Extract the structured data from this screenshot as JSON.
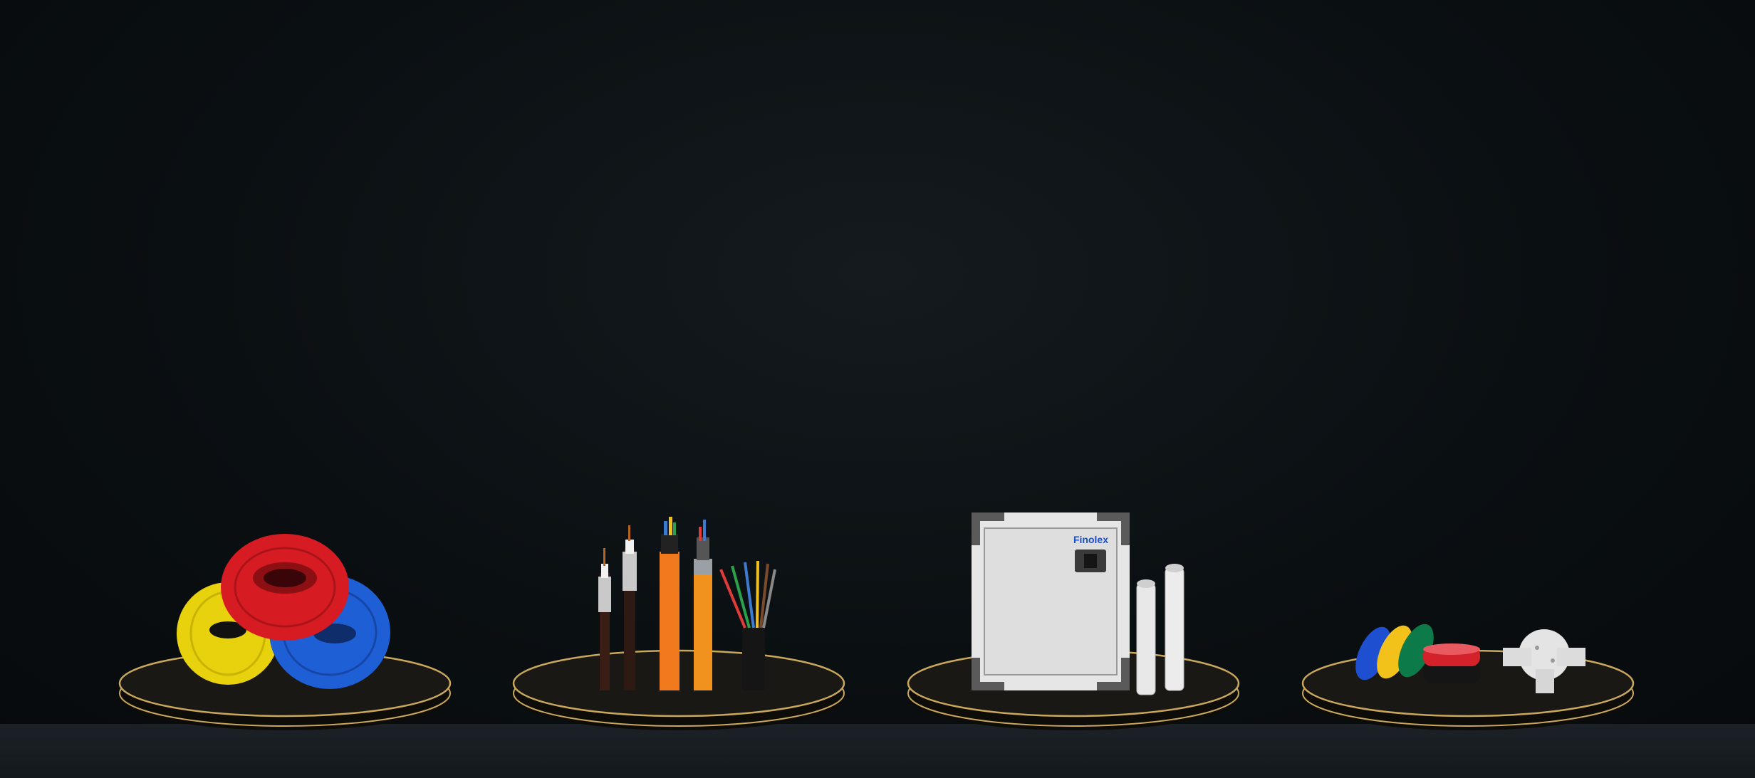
{
  "scene": {
    "background_color": "#0a0f12",
    "floor_color": "#161b1f",
    "pedestal_rim_color": "#c9a85c"
  },
  "products": [
    {
      "id": "wire-coils",
      "icon": "wire-coils-icon",
      "colors": [
        "#e8d20e",
        "#d71b22",
        "#1f5fd6"
      ]
    },
    {
      "id": "cables",
      "icon": "cable-set-icon",
      "colors": [
        "#f07a1d",
        "#3a1d14",
        "#1a1a1a"
      ]
    },
    {
      "id": "distribution-box",
      "icon": "distribution-box-icon",
      "brand": "Finolex"
    },
    {
      "id": "accessories",
      "icon": "tape-and-junction-box-icon",
      "colors": [
        "#1d4fd0",
        "#f2c21b",
        "#0d7a4a",
        "#d4222b",
        "#1a1a1a"
      ]
    }
  ]
}
